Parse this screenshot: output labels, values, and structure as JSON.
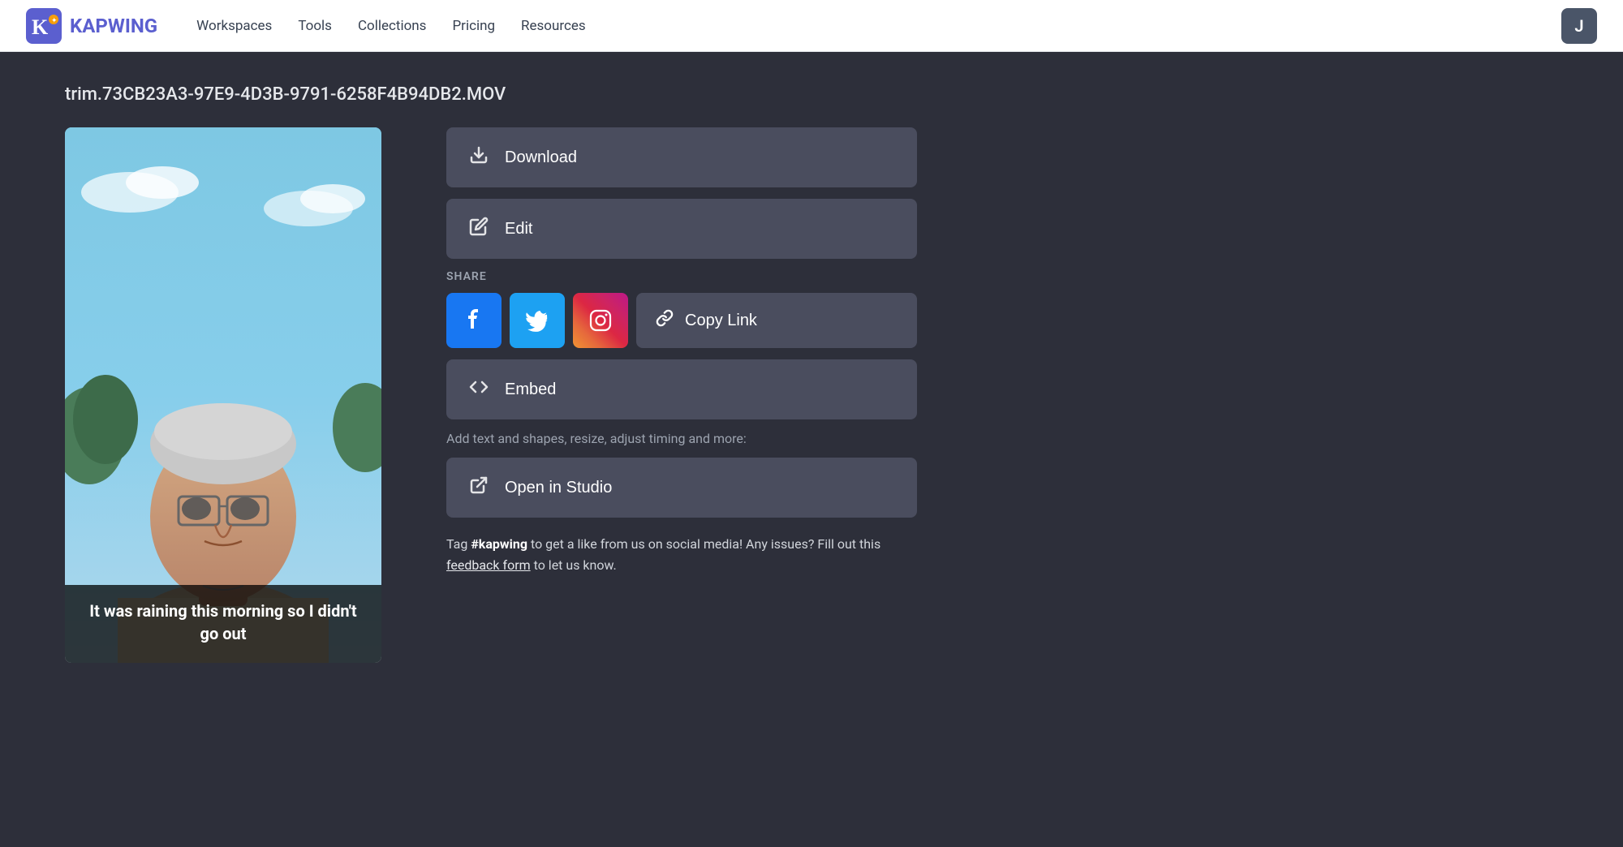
{
  "navbar": {
    "logo_text": "KAPWING",
    "nav_items": [
      {
        "label": "Workspaces",
        "id": "workspaces"
      },
      {
        "label": "Tools",
        "id": "tools"
      },
      {
        "label": "Collections",
        "id": "collections"
      },
      {
        "label": "Pricing",
        "id": "pricing"
      },
      {
        "label": "Resources",
        "id": "resources"
      }
    ],
    "user_initial": "J"
  },
  "page": {
    "file_title": "trim.73CB23A3-97E9-4D3B-9791-6258F4B94DB2.MOV"
  },
  "actions": {
    "download_label": "Download",
    "edit_label": "Edit",
    "share_label": "SHARE",
    "copy_link_label": "Copy Link",
    "embed_label": "Embed",
    "open_studio_label": "Open in Studio"
  },
  "social": {
    "facebook_icon": "f",
    "twitter_icon": "t",
    "instagram_icon": "i"
  },
  "video": {
    "subtitle": "It was raining this morning so I didn't go out"
  },
  "tag_section": {
    "prefix": "Tag ",
    "hashtag": "#kapwing",
    "middle": " to get a like from us on social media! Any issues? Fill out this ",
    "link_text": "feedback form",
    "suffix": " to let us know."
  }
}
